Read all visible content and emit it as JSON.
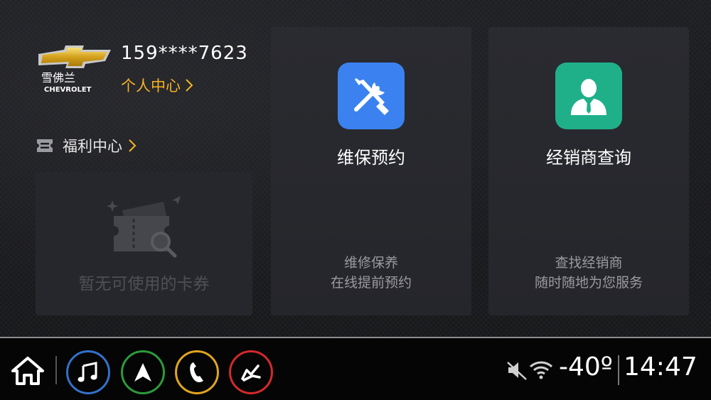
{
  "account": {
    "brand_logo": "chevrolet-bowtie-logo",
    "brand_cn": "雪佛兰",
    "brand_en": "CHEVROLET",
    "phone": "159****7623",
    "personal_center": "个人中心"
  },
  "welfare": {
    "label": "福利中心",
    "empty_text": "暂无可使用的卡券"
  },
  "cards": {
    "maintenance": {
      "icon": "wrench-screwdriver-icon",
      "title": "维保预约",
      "desc_line1": "维修保养",
      "desc_line2": "在线提前预约"
    },
    "dealer": {
      "icon": "dealer-person-icon",
      "title": "经销商查询",
      "desc_line1": "查找经销商",
      "desc_line2": "随时随地为您服务"
    }
  },
  "statusbar": {
    "temperature": "-40º",
    "time": "14:47"
  },
  "colors": {
    "accent_orange": "#f5b323",
    "maint_blue": "#3b82f0",
    "dealer_green": "#1fb08a",
    "music_ring": "#3471c9",
    "nav_ring": "#2d9a3c",
    "phone_ring": "#e1a41f",
    "seat_ring": "#d4292c"
  },
  "dock": [
    "home-icon",
    "music-icon",
    "navigation-icon",
    "phone-icon",
    "seat-icon"
  ]
}
